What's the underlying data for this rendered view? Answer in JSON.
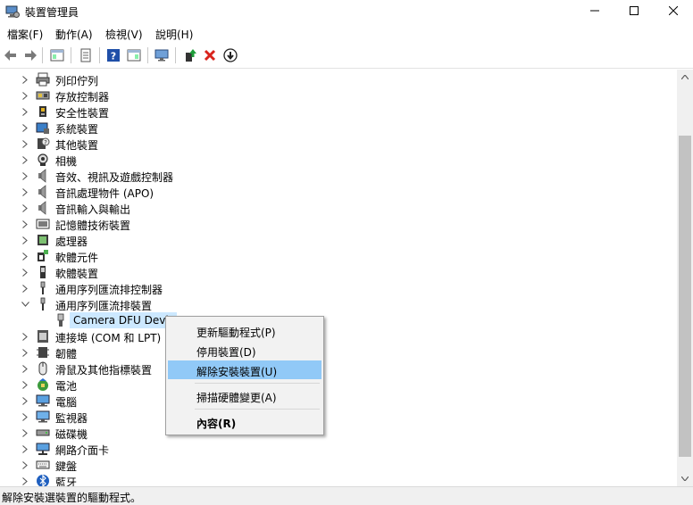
{
  "window": {
    "title": "裝置管理員"
  },
  "menubar": {
    "items": [
      "檔案(F)",
      "動作(A)",
      "檢視(V)",
      "說明(H)"
    ]
  },
  "toolbar": {
    "buttons": [
      "back-icon",
      "forward-icon",
      "show-hide-console-tree-icon",
      "properties-icon",
      "help-icon",
      "show-action-pane-icon",
      "scan-hardware-icon",
      "update-driver-icon",
      "uninstall-device-icon",
      "disable-device-icon"
    ]
  },
  "tree": {
    "items": [
      {
        "label": "列印佇列",
        "icon": "printer-icon",
        "expanded": false
      },
      {
        "label": "存放控制器",
        "icon": "storage-controller-icon",
        "expanded": false
      },
      {
        "label": "安全性裝置",
        "icon": "security-device-icon",
        "expanded": false
      },
      {
        "label": "系統裝置",
        "icon": "system-device-icon",
        "expanded": false
      },
      {
        "label": "其他裝置",
        "icon": "other-device-icon",
        "expanded": false
      },
      {
        "label": "相機",
        "icon": "camera-icon",
        "expanded": false
      },
      {
        "label": "音效、視訊及遊戲控制器",
        "icon": "speaker-icon",
        "expanded": false
      },
      {
        "label": "音訊處理物件 (APO)",
        "icon": "speaker-icon",
        "expanded": false
      },
      {
        "label": "音訊輸入與輸出",
        "icon": "speaker-icon",
        "expanded": false
      },
      {
        "label": "記憶體技術裝置",
        "icon": "memory-icon",
        "expanded": false
      },
      {
        "label": "處理器",
        "icon": "processor-icon",
        "expanded": false
      },
      {
        "label": "軟體元件",
        "icon": "software-component-icon",
        "expanded": false
      },
      {
        "label": "軟體裝置",
        "icon": "software-device-icon",
        "expanded": false
      },
      {
        "label": "通用序列匯流排控制器",
        "icon": "usb-icon",
        "expanded": false
      },
      {
        "label": "通用序列匯流排裝置",
        "icon": "usb-icon",
        "expanded": true
      },
      {
        "label": "Camera DFU Devic",
        "icon": "usb-device-icon",
        "child": true,
        "selected": true
      },
      {
        "label": "連接埠 (COM 和 LPT)",
        "icon": "port-icon",
        "expanded": false
      },
      {
        "label": "韌體",
        "icon": "firmware-icon",
        "expanded": false
      },
      {
        "label": "滑鼠及其他指標裝置",
        "icon": "mouse-icon",
        "expanded": false
      },
      {
        "label": "電池",
        "icon": "battery-icon",
        "expanded": false
      },
      {
        "label": "電腦",
        "icon": "computer-icon",
        "expanded": false
      },
      {
        "label": "監視器",
        "icon": "monitor-icon",
        "expanded": false
      },
      {
        "label": "磁碟機",
        "icon": "disk-drive-icon",
        "expanded": false
      },
      {
        "label": "網路介面卡",
        "icon": "network-adapter-icon",
        "expanded": false
      },
      {
        "label": "鍵盤",
        "icon": "keyboard-icon",
        "expanded": false
      },
      {
        "label": "藍牙",
        "icon": "bluetooth-icon",
        "expanded": false
      }
    ]
  },
  "context_menu": {
    "items": [
      {
        "label": "更新驅動程式(P)"
      },
      {
        "label": "停用裝置(D)"
      },
      {
        "label": "解除安裝裝置(U)",
        "highlighted": true
      },
      {
        "label": "掃描硬體變更(A)"
      },
      {
        "label": "內容(R)",
        "bold": true
      }
    ]
  },
  "statusbar": {
    "text": "解除安裝選裝置的驅動程式。"
  },
  "colors": {
    "selection": "#cce8ff",
    "menu_highlight": "#91c9f7",
    "help_blue": "#1f4fa8",
    "uninstall_red": "#d9231c"
  }
}
